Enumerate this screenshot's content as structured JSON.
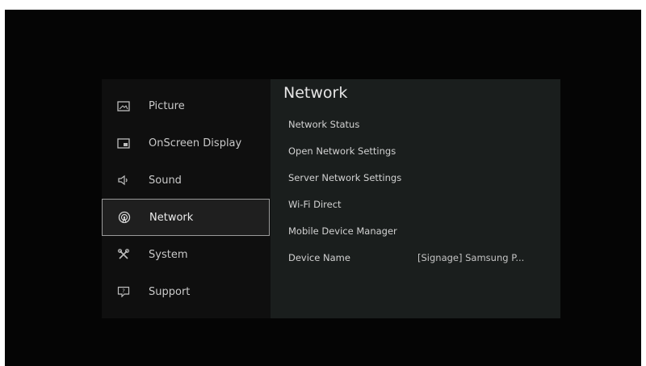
{
  "sidebar": {
    "items": [
      {
        "label": "Picture",
        "icon": "picture-icon"
      },
      {
        "label": "OnScreen Display",
        "icon": "onscreen-display-icon"
      },
      {
        "label": "Sound",
        "icon": "speaker-icon"
      },
      {
        "label": "Network",
        "icon": "network-icon",
        "selected": true
      },
      {
        "label": "System",
        "icon": "tools-icon"
      },
      {
        "label": "Support",
        "icon": "support-icon"
      }
    ]
  },
  "network": {
    "title": "Network",
    "items": [
      {
        "label": "Network Status"
      },
      {
        "label": "Open Network Settings"
      },
      {
        "label": "Server Network Settings"
      },
      {
        "label": "Wi-Fi Direct"
      },
      {
        "label": "Mobile Device Manager"
      },
      {
        "label": "Device Name",
        "value": "[Signage] Samsung P..."
      }
    ]
  },
  "colors": {
    "screen_background": "#050505",
    "content_background": "#1a1e1d",
    "selection_border": "#9a9a9a"
  }
}
